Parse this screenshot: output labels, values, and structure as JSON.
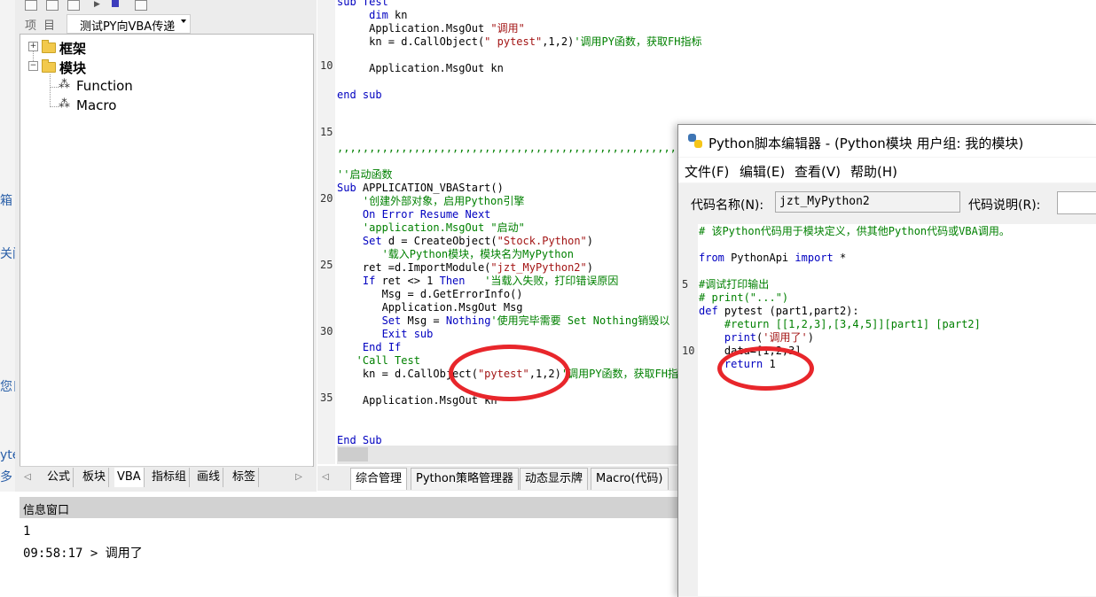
{
  "left_strip": {
    "fragments": [
      "箱",
      "关闭",
      "您日",
      "yte",
      "多"
    ]
  },
  "left_panel": {
    "combo_label": "项目",
    "combo_value": "测试PY向VBA传递",
    "tree": {
      "nodes": [
        {
          "label": "框架",
          "expander": "+"
        },
        {
          "label": "模块",
          "expander": "−"
        },
        {
          "label": "Function"
        },
        {
          "label": "Macro"
        }
      ]
    },
    "tabs": [
      "公式",
      "板块",
      "VBA",
      "指标组",
      "画线",
      "标签"
    ]
  },
  "code_editor": {
    "line_numbers": [
      "10",
      "15",
      "20",
      "25",
      "30",
      "35"
    ],
    "lines": [
      [
        {
          "t": "sub Test",
          "c": "kw"
        }
      ],
      [
        {
          "t": "     ",
          "c": "plain"
        },
        {
          "t": "dim",
          "c": "kw"
        },
        {
          "t": " kn",
          "c": "plain"
        }
      ],
      [
        {
          "t": "     Application.MsgOut ",
          "c": "plain"
        },
        {
          "t": "\"调用\"",
          "c": "str"
        }
      ],
      [
        {
          "t": "     kn = d.CallObject(",
          "c": "plain"
        },
        {
          "t": "\" pytest\"",
          "c": "str"
        },
        {
          "t": ",1,2)",
          "c": "plain"
        },
        {
          "t": "'调用PY函数，获取FH指标",
          "c": "cm"
        }
      ],
      [
        {
          "t": "",
          "c": "plain"
        }
      ],
      [
        {
          "t": "     Application.MsgOut kn",
          "c": "plain"
        }
      ],
      [
        {
          "t": "",
          "c": "plain"
        }
      ],
      [
        {
          "t": "end sub",
          "c": "kw"
        }
      ],
      [
        {
          "t": "",
          "c": "plain"
        }
      ],
      [
        {
          "t": "",
          "c": "plain"
        }
      ],
      [
        {
          "t": "",
          "c": "plain"
        }
      ],
      [
        {
          "t": ",,,,,,,,,,,,,,,,,,,,,,,,,,,,,,,,,,,,,,,,,,,,,,,,,,,,,,,,,,,,,,,,,",
          "c": "cm"
        }
      ],
      [
        {
          "t": "",
          "c": "plain"
        }
      ],
      [
        {
          "t": "''启动函数",
          "c": "cm"
        }
      ],
      [
        {
          "t": "Sub",
          "c": "kw"
        },
        {
          "t": " APPLICATION_VBAStart()",
          "c": "plain"
        }
      ],
      [
        {
          "t": "    '创建外部对象，启用Python引擎",
          "c": "cm"
        }
      ],
      [
        {
          "t": "    ",
          "c": "plain"
        },
        {
          "t": "On Error Resume Next",
          "c": "kw"
        }
      ],
      [
        {
          "t": "    'application.MsgOut \"启动\"",
          "c": "cm"
        }
      ],
      [
        {
          "t": "    ",
          "c": "plain"
        },
        {
          "t": "Set",
          "c": "kw"
        },
        {
          "t": " d = CreateObject(",
          "c": "plain"
        },
        {
          "t": "\"Stock.Python\"",
          "c": "str"
        },
        {
          "t": ")",
          "c": "plain"
        }
      ],
      [
        {
          "t": "       '载入Python模块，模块名为MyPython",
          "c": "cm"
        }
      ],
      [
        {
          "t": "    ret =d.ImportModule(",
          "c": "plain"
        },
        {
          "t": "\"jzt_MyPython2\"",
          "c": "str"
        },
        {
          "t": ")",
          "c": "plain"
        }
      ],
      [
        {
          "t": "    ",
          "c": "plain"
        },
        {
          "t": "If",
          "c": "kw"
        },
        {
          "t": " ret <> 1 ",
          "c": "plain"
        },
        {
          "t": "Then",
          "c": "kw"
        },
        {
          "t": "   '当载入失败，打印错误原因",
          "c": "cm"
        }
      ],
      [
        {
          "t": "       Msg = d.GetErrorInfo()",
          "c": "plain"
        }
      ],
      [
        {
          "t": "       Application.MsgOut Msg",
          "c": "plain"
        }
      ],
      [
        {
          "t": "       ",
          "c": "plain"
        },
        {
          "t": "Set",
          "c": "kw"
        },
        {
          "t": " Msg = ",
          "c": "plain"
        },
        {
          "t": "Nothing",
          "c": "kw"
        },
        {
          "t": "'使用完毕需要 Set Nothing销毁以",
          "c": "cm"
        }
      ],
      [
        {
          "t": "       ",
          "c": "plain"
        },
        {
          "t": "Exit sub",
          "c": "kw"
        }
      ],
      [
        {
          "t": "    ",
          "c": "plain"
        },
        {
          "t": "End If",
          "c": "kw"
        }
      ],
      [
        {
          "t": "   'Call Test",
          "c": "cm"
        }
      ],
      [
        {
          "t": "    kn = d.CallObject(",
          "c": "plain"
        },
        {
          "t": "\"pytest\"",
          "c": "str"
        },
        {
          "t": ",1,2)",
          "c": "plain"
        },
        {
          "t": "'调用PY函数，获取FH指",
          "c": "cm"
        }
      ],
      [
        {
          "t": "",
          "c": "plain"
        }
      ],
      [
        {
          "t": "    Application.MsgOut kn",
          "c": "plain"
        }
      ],
      [
        {
          "t": "",
          "c": "plain"
        }
      ],
      [
        {
          "t": "",
          "c": "plain"
        }
      ],
      [
        {
          "t": "End Sub",
          "c": "kw"
        }
      ]
    ]
  },
  "center_tabs": [
    "综合管理",
    "Python策略管理器",
    "动态显示牌",
    "Macro(代码)"
  ],
  "info_window": {
    "title": "信息窗口",
    "lines": [
      "1",
      "09:58:17 > 调用了"
    ]
  },
  "python_editor": {
    "title": "Python脚本编辑器 - (Python模块 用户组: 我的模块)",
    "menu": [
      "文件(F)",
      "编辑(E)",
      "查看(V)",
      "帮助(H)"
    ],
    "code_name_label": "代码名称(N):",
    "code_name_value": "jzt_MyPython2",
    "code_desc_label": "代码说明(R):",
    "line_numbers": [
      "5",
      "10"
    ],
    "lines": [
      [
        {
          "t": "# 该Python代码用于模块定义，供其他Python代码或VBA调用。",
          "c": "cm"
        }
      ],
      [
        {
          "t": "",
          "c": "plain"
        }
      ],
      [
        {
          "t": "from",
          "c": "kw"
        },
        {
          "t": " PythonApi ",
          "c": "plain"
        },
        {
          "t": "import",
          "c": "kw"
        },
        {
          "t": " *",
          "c": "plain"
        }
      ],
      [
        {
          "t": "",
          "c": "plain"
        }
      ],
      [
        {
          "t": "#调试打印输出",
          "c": "cm"
        }
      ],
      [
        {
          "t": "# print(\"...\")",
          "c": "cm"
        }
      ],
      [
        {
          "t": "def",
          "c": "kw"
        },
        {
          "t": " pytest (part1,part2):",
          "c": "plain"
        }
      ],
      [
        {
          "t": "    #return [[1,2,3],[3,4,5]][part1] [part2]",
          "c": "cm"
        }
      ],
      [
        {
          "t": "    ",
          "c": "plain"
        },
        {
          "t": "print",
          "c": "kw"
        },
        {
          "t": "(",
          "c": "plain"
        },
        {
          "t": "'调用了'",
          "c": "str"
        },
        {
          "t": ")",
          "c": "plain"
        }
      ],
      [
        {
          "t": "    data=[1,2,3]",
          "c": "plain"
        }
      ],
      [
        {
          "t": "    ",
          "c": "plain"
        },
        {
          "t": "return",
          "c": "kw"
        },
        {
          "t": " 1",
          "c": "plain"
        }
      ]
    ]
  },
  "colors": {
    "keyword": "#0000c0",
    "string": "#a31515",
    "comment": "#008000",
    "annotation": "#e8262b"
  }
}
